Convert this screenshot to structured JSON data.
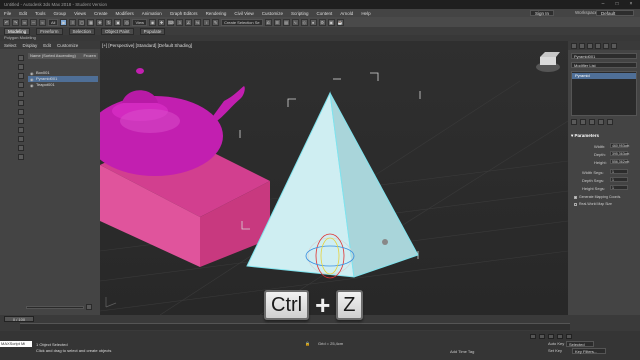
{
  "title": "Untitled - Autodesk 3ds Max 2018 - Student Version",
  "window_controls": [
    "–",
    "□",
    "×"
  ],
  "menu": [
    "File",
    "Edit",
    "Tools",
    "Group",
    "Views",
    "Create",
    "Modifiers",
    "Animation",
    "Graph Editors",
    "Rendering",
    "Civil View",
    "Customize",
    "Scripting",
    "Content",
    "Arnold",
    "Help"
  ],
  "signin": "Sign In",
  "workspaces_label": "Workspaces:",
  "workspace": "Default",
  "toolbar": {
    "filter": "All",
    "view": "View",
    "selset": "Create Selection Se"
  },
  "ribbon": {
    "tabs": [
      "Modeling",
      "Freeform",
      "Selection",
      "Object Paint",
      "Populate"
    ],
    "active": 0,
    "sub": "Polygon Modeling"
  },
  "explorer": {
    "tabs": [
      "Select",
      "Display",
      "Edit",
      "Customize"
    ],
    "header": "Name (Sorted Ascending)",
    "frozen": "Frozen",
    "rows": [
      "Box001",
      "Pyramid001",
      "Teapot001"
    ],
    "selected": 1,
    "default": "Default"
  },
  "viewport_label": "[+] [Perspective] [Standard] [Default Shading]",
  "right": {
    "object_name": "Pyramid001",
    "modifier_list": "Modifier List",
    "stack_item": "Pyramid",
    "section": "Parameters",
    "params": [
      {
        "label": "Width:",
        "value": "460,953cm"
      },
      {
        "label": "Depth:",
        "value": "395,363cm"
      },
      {
        "label": "Height:",
        "value": "556,362cm"
      }
    ],
    "segs": [
      {
        "label": "Width Segs:",
        "value": "1"
      },
      {
        "label": "Depth Segs:",
        "value": "1"
      },
      {
        "label": "Height Segs:",
        "value": "1"
      }
    ],
    "checks": [
      "Generate Mapping Coords.",
      "Real-World Map Size"
    ]
  },
  "timeline": {
    "frame": "0 / 100"
  },
  "status": {
    "maxscript": "MAXScript Mi",
    "objects": "1 Object Selected",
    "hint": "Click and drag to select and create objects",
    "grid": "Grid = 25,4cm",
    "add_time_tag": "Add Time Tag",
    "auto_key": "Auto Key",
    "set_key": "Set Key",
    "selected": "Selected",
    "key_filters": "Key Filters..."
  },
  "shortcut": {
    "key1": "Ctrl",
    "plus": "+",
    "key2": "Z"
  },
  "colors": {
    "teapot": "#c21fb0",
    "box": "#d13d8c",
    "pyramid": "#cfeef2",
    "selection": "#4f6f97"
  }
}
